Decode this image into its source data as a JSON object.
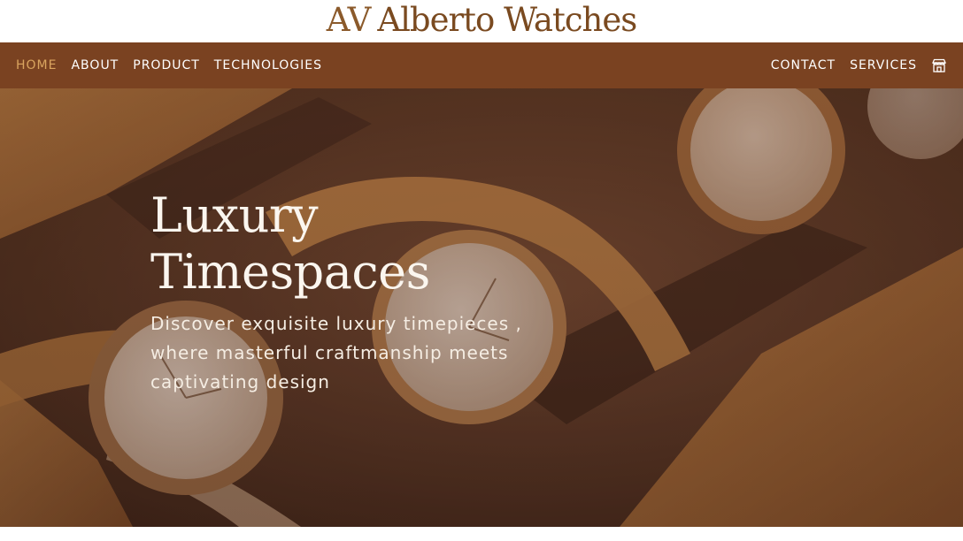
{
  "brand": {
    "mark": "AV",
    "name": "Alberto Watches"
  },
  "nav": {
    "left": [
      {
        "label": "HOME",
        "active": true
      },
      {
        "label": "ABOUT"
      },
      {
        "label": "PRODUCT"
      },
      {
        "label": "TECHNOLOGIES"
      }
    ],
    "right": [
      {
        "label": "CONTACT"
      },
      {
        "label": "SERVICES"
      }
    ],
    "store_icon": "store-icon"
  },
  "hero": {
    "title_line1": "Luxury",
    "title_line2": "Timespaces",
    "subtitle_line1": "Discover exquisite luxury timepieces ,",
    "subtitle_line2": "where masterful craftmanship meets",
    "subtitle_line3": "captivating design"
  },
  "colors": {
    "nav_bg": "#7a4221",
    "nav_active": "#d9a45f",
    "logo": "#7a4a20"
  }
}
